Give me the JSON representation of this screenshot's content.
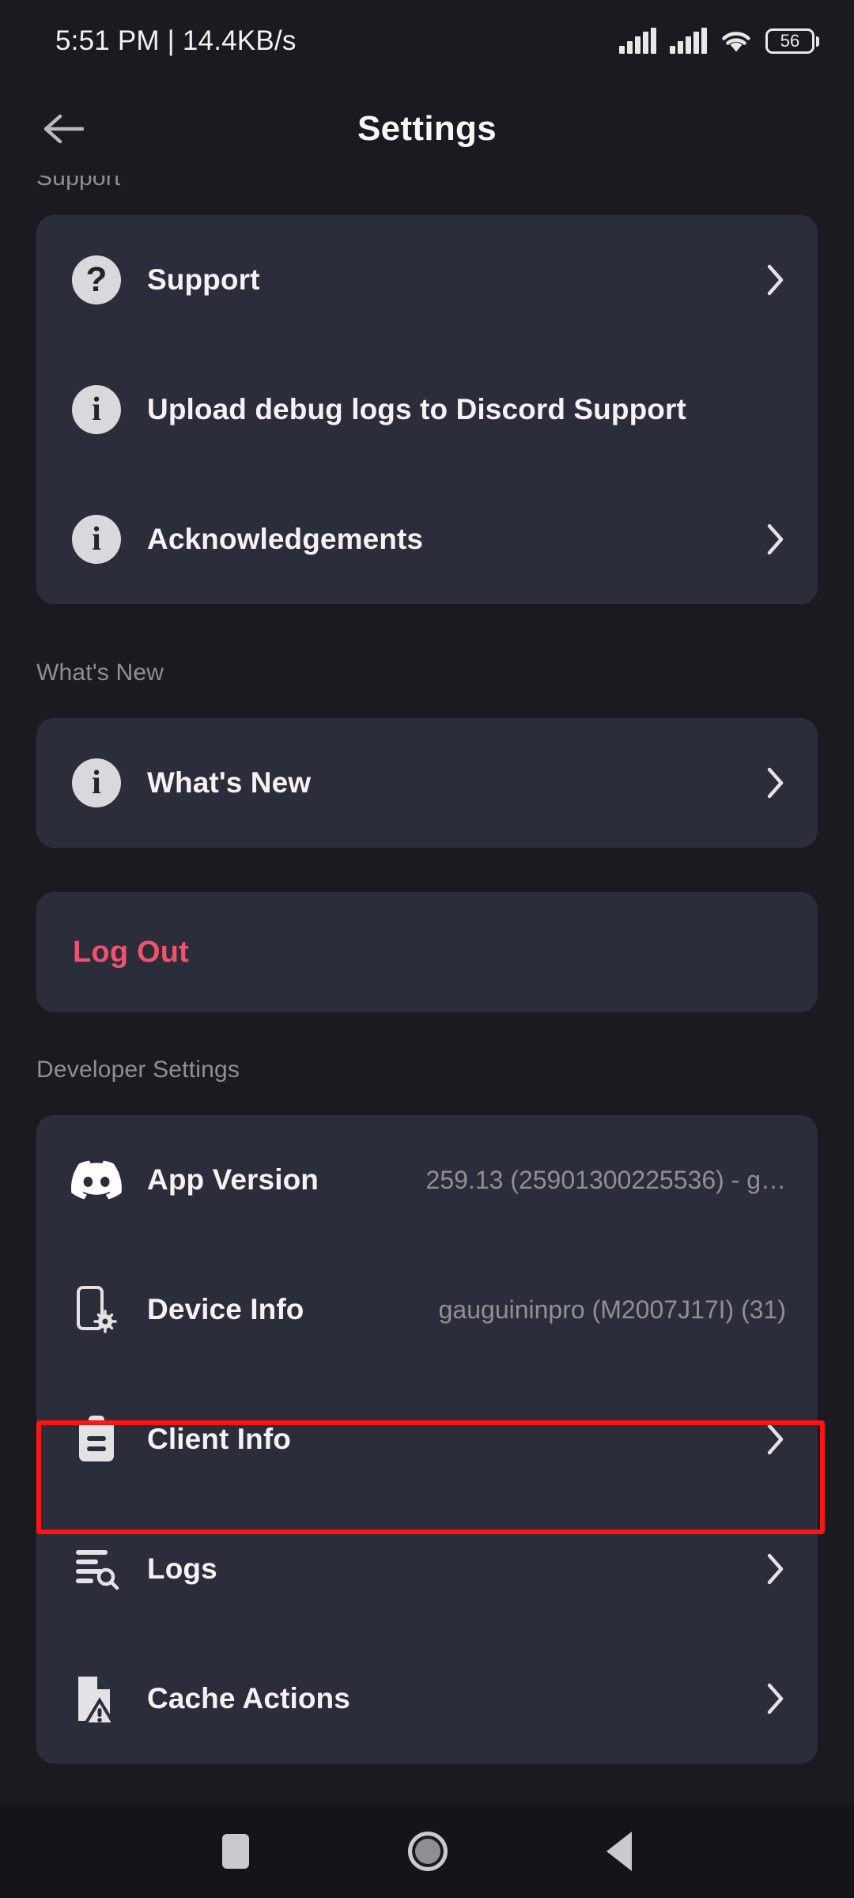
{
  "status_bar": {
    "time_and_rate": "5:51 PM | 14.4KB/s",
    "battery_level": "56",
    "signal_icon": "cellular-signal-icon",
    "signal_icon_2": "cellular-signal-icon-2",
    "wifi_icon": "wifi-icon",
    "battery_icon": "battery-icon"
  },
  "app_bar": {
    "title": "Settings",
    "back_icon": "back-arrow-icon"
  },
  "sections": {
    "support": {
      "label": "Support",
      "items": [
        {
          "label": "Support",
          "icon": "question-mark-circle-icon",
          "chevron": true,
          "value": ""
        },
        {
          "label": "Upload debug logs to Discord Support",
          "icon": "info-circle-icon",
          "chevron": false,
          "value": ""
        },
        {
          "label": "Acknowledgements",
          "icon": "info-circle-icon",
          "chevron": true,
          "value": ""
        }
      ]
    },
    "whats_new": {
      "label": "What's New",
      "items": [
        {
          "label": "What's New",
          "icon": "info-circle-icon",
          "chevron": true,
          "value": ""
        }
      ]
    },
    "logout": {
      "label": "Log Out",
      "color": "#f0536b"
    },
    "developer_settings": {
      "label": "Developer Settings",
      "items": [
        {
          "label": "App Version",
          "icon": "discord-logo-icon",
          "value": "259.13 (25901300225536) - g…",
          "chevron": false
        },
        {
          "label": "Device Info",
          "icon": "device-settings-icon",
          "value": "gauguininpro (M2007J17I) (31)",
          "chevron": false
        },
        {
          "label": "Client Info",
          "icon": "clipboard-icon",
          "value": "",
          "chevron": true,
          "highlighted": true
        },
        {
          "label": "Logs",
          "icon": "logs-search-icon",
          "value": "",
          "chevron": true
        },
        {
          "label": "Cache Actions",
          "icon": "file-warning-icon",
          "value": "",
          "chevron": true
        }
      ]
    }
  },
  "annotation": {
    "highlight_color": "#ff1313",
    "target": "Client Info"
  },
  "nav_bar": {
    "recents_icon": "recents-square-icon",
    "home_icon": "home-circle-icon",
    "back_icon": "back-triangle-icon"
  },
  "theme": {
    "page_background": "#1a1b20",
    "card_background": "#2b2d3a",
    "primary_text": "#f3f3f4",
    "secondary_text": "#8f9096",
    "danger": "#f0536b"
  }
}
